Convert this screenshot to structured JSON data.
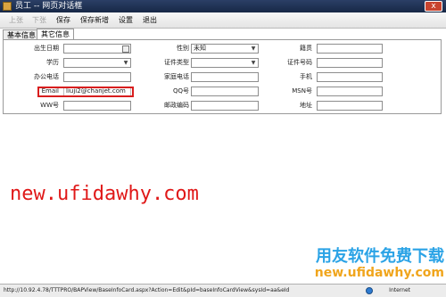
{
  "window": {
    "title": "员工 -- 网页对话框",
    "close_label": "x"
  },
  "toolbar": {
    "prev": "上张",
    "next": "下张",
    "save": "保存",
    "save_new": "保存新增",
    "settings": "设置",
    "exit": "退出"
  },
  "tabs": [
    {
      "label": "基本信息",
      "active": false
    },
    {
      "label": "其它信息",
      "active": true
    }
  ],
  "form": {
    "birth_date_label": "出生日期",
    "gender_label": "性别",
    "gender_value": "未知",
    "native_place_label": "籍贯",
    "education_label": "学历",
    "id_type_label": "证件类型",
    "id_number_label": "证件号码",
    "office_phone_label": "办公电话",
    "home_phone_label": "家庭电话",
    "mobile_label": "手机",
    "email_label": "Email",
    "email_value": "liuji2@chanjet.com",
    "qq_label": "QQ号",
    "msn_label": "MSN号",
    "ww_label": "WW号",
    "postcode_label": "邮政编码",
    "address_label": "地址"
  },
  "watermark": {
    "red_text": "new.ufidawhy.com",
    "brand_text": "用友软件免费下载",
    "brand_url": "new.ufidawhy.com"
  },
  "statusbar": {
    "url": "http://10.92.4.78/TTTPRO/BAPView/BaseInfoCard.aspx?Action=Edit&pId=baseInfoCardView&sysId=aa&eId",
    "zone": "Internet"
  },
  "colors": {
    "highlight": "#d81e1e",
    "brand_blue": "#2ba3e6",
    "brand_orange": "#f0a51c"
  }
}
